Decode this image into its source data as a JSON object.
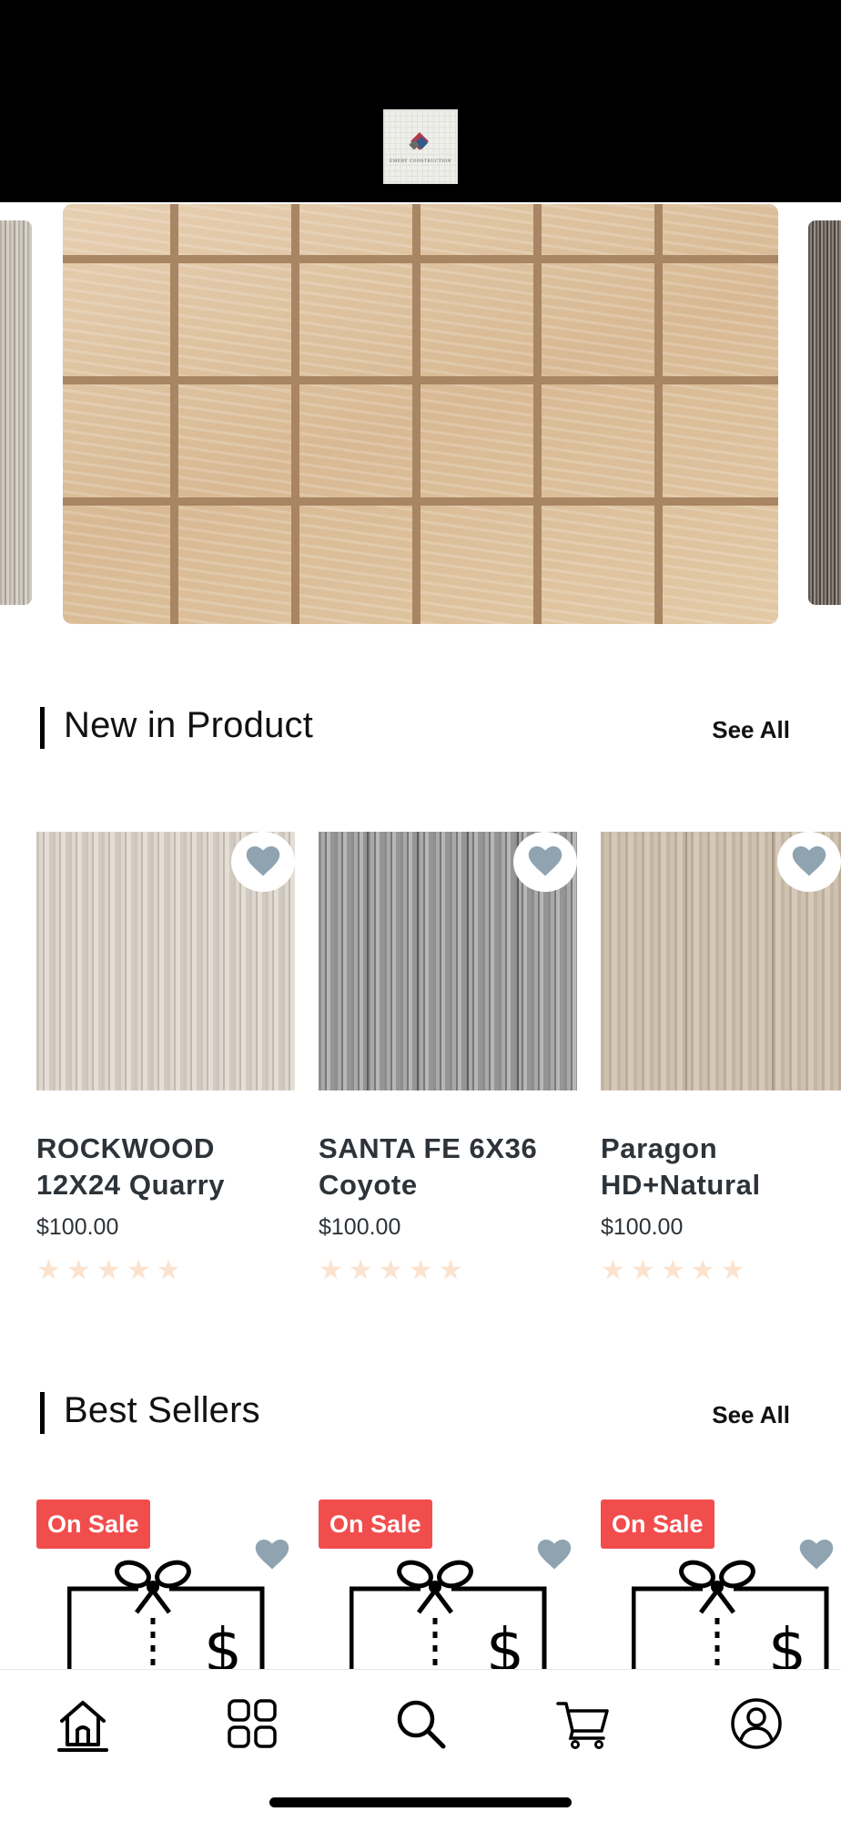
{
  "header": {
    "logo_text": "EMERY CONSTRUCTION"
  },
  "banner": {
    "image": "travertine-mosaic-tile"
  },
  "new_in_product": {
    "title": "New in Product",
    "see_all": "See All",
    "items": [
      {
        "title_line1": "ROCKWOOD",
        "title_line2": "12X24 Quarry",
        "price": "$100.00",
        "rating": 5,
        "image": "light-grey-vein-tile"
      },
      {
        "title_line1": "SANTA FE 6X36",
        "title_line2": "Coyote",
        "price": "$100.00",
        "rating": 5,
        "image": "grey-wood-plank-tile"
      },
      {
        "title_line1": "Paragon",
        "title_line2": "HD+Natural",
        "price": "$100.00",
        "rating": 5,
        "image": "natural-oak-plank"
      }
    ]
  },
  "best_sellers": {
    "title": "Best Sellers",
    "see_all": "See All",
    "items": [
      {
        "badge": "On Sale",
        "image": "gift-card-icon"
      },
      {
        "badge": "On Sale",
        "image": "gift-card-icon"
      },
      {
        "badge": "On Sale",
        "image": "gift-card-icon"
      }
    ]
  },
  "nav": {
    "items": [
      "home-icon",
      "categories-icon",
      "search-icon",
      "cart-icon",
      "profile-icon"
    ],
    "active": "home-icon"
  },
  "colors": {
    "sale_badge": "#f24d4d",
    "heart": "#8fa3b1",
    "star_inactive": "#fbe3cf",
    "header_bg": "#000000"
  }
}
